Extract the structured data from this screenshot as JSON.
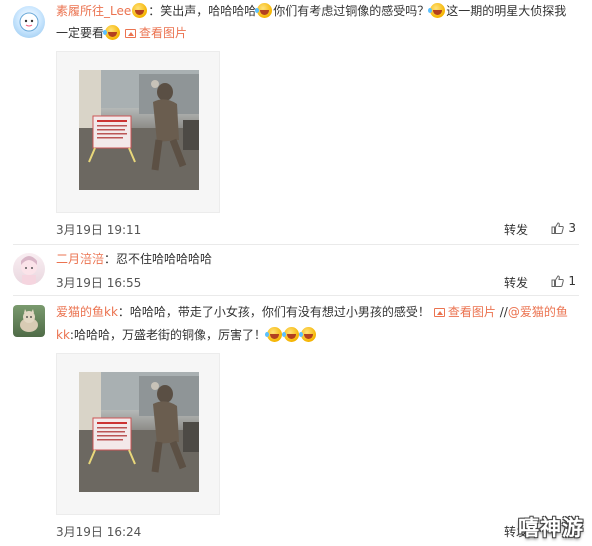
{
  "comments": [
    {
      "username": "素履所往_Lee",
      "line1_a": "：笑出声，哈哈哈哈",
      "line1_b": "你们有考虑过铜像的感受吗？",
      "line1_c": "这一期的明星大侦探我",
      "line2": "一定要看",
      "view_pic": "查看图片",
      "time": "3月19日 19:11",
      "repost": "转发",
      "likes": "3"
    },
    {
      "username": "二月涪涪",
      "text": "：忍不住哈哈哈哈哈",
      "time": "3月19日 16:55",
      "repost": "转发",
      "likes": "1"
    },
    {
      "username": "爱猫的鱼kk",
      "line1_a": "：哈哈哈，带走了小女孩，你们有没有想过小男孩的感受！",
      "view_pic": "查看图片",
      "repost_sep": " //",
      "repost_user": "@爱猫的鱼",
      "line2_user": "kk",
      "line2": ":哈哈哈，万盛老街的铜像，厉害了！",
      "time": "3月19日 16:24",
      "repost": "转发"
    }
  ],
  "watermark": "嘻神游",
  "icons": [
    "avatar",
    "laugh-emoji",
    "picture-icon",
    "thumbs-up-icon",
    "bronze-statue-photo"
  ],
  "colors": {
    "link": "#eb7350",
    "divider": "#eaeaea"
  }
}
